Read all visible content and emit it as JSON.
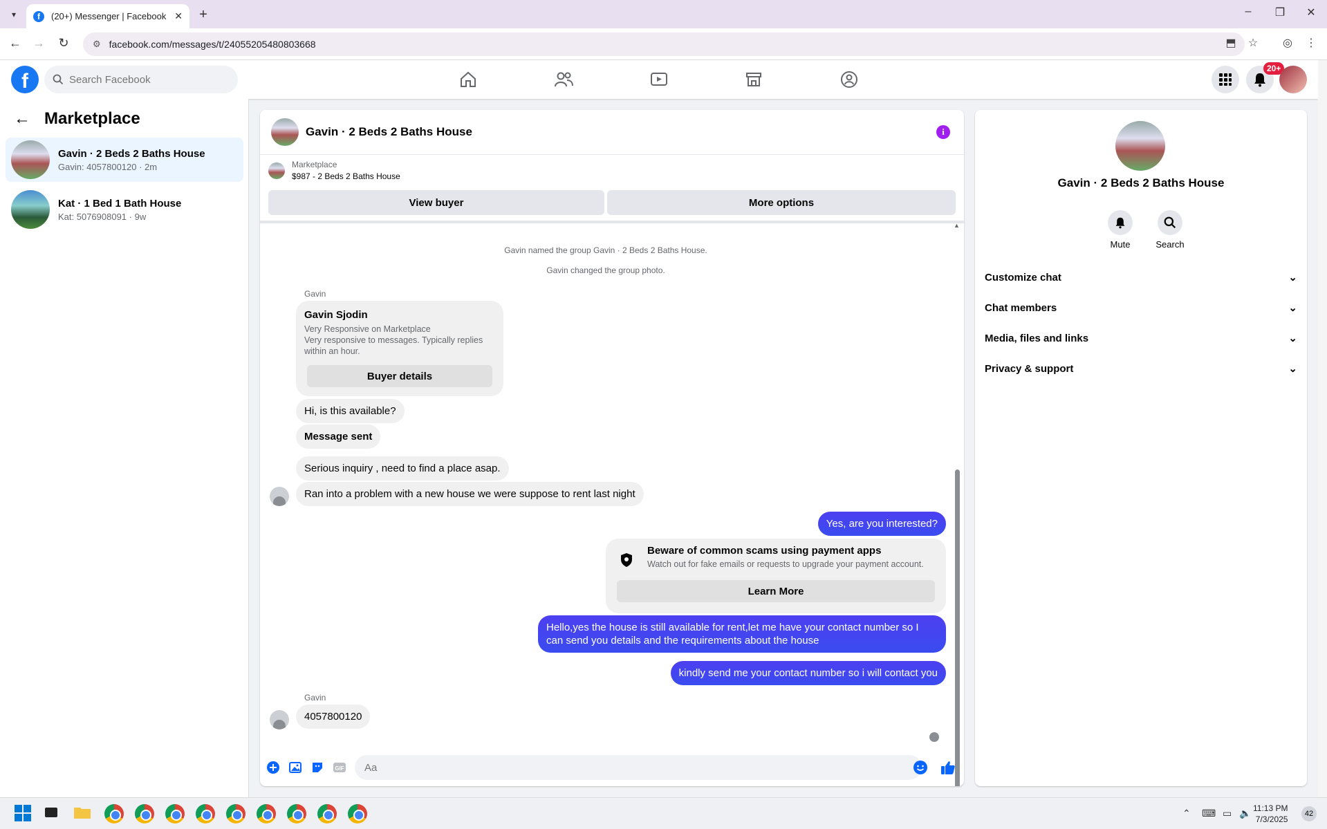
{
  "browser": {
    "tab_title": "(20+) Messenger | Facebook",
    "url": "facebook.com/messages/t/24055205480803668"
  },
  "fb": {
    "logo": "f",
    "search_placeholder": "Search Facebook",
    "notif_badge": "20+",
    "nav_icons": [
      "home-icon",
      "friends-icon",
      "video-icon",
      "marketplace-icon",
      "groups-icon"
    ]
  },
  "sidebar": {
    "title": "Marketplace",
    "conversations": [
      {
        "title": "Gavin · 2 Beds 2 Baths House",
        "subtitle": "Gavin: 4057800120 · 2m"
      },
      {
        "title": "Kat · 1 Bed 1 Bath House",
        "subtitle": "Kat: 5076908091 · 9w"
      }
    ]
  },
  "chat": {
    "title": "Gavin · 2 Beds 2 Baths House",
    "marketplace_label": "Marketplace",
    "listing": "$987 - 2 Beds 2 Baths House",
    "view_buyer": "View buyer",
    "more_options": "More options",
    "system_messages": [
      "Gavin named the group Gavin · 2 Beds 2 Baths House.",
      "Gavin changed the group photo."
    ],
    "sender_name": "Gavin",
    "buyer_card": {
      "name": "Gavin Sjodin",
      "line1": "Very Responsive on Marketplace",
      "line2": "Very responsive to messages. Typically replies",
      "line3": "within an hour.",
      "button": "Buyer details"
    },
    "messages": {
      "m1": "Hi, is this available?",
      "m2": "Message sent",
      "m3": "Serious inquiry , need to find a place asap.",
      "m4": "Ran into a problem with a new house we were suppose to rent last night",
      "m5": "Yes, are you interested?",
      "m6a": "Hello,yes the house is still available for rent,let me have your contact number   so I",
      "m6b": "can send you details and the requirements about the house",
      "m7": "kindly send me your contact number so i will contact you",
      "m8": "4057800120"
    },
    "scam_notice": {
      "title": "Beware of common scams using payment apps",
      "body": "Watch out for fake emails or requests to upgrade your payment account.",
      "button": "Learn More"
    },
    "composer_placeholder": "Aa"
  },
  "info_panel": {
    "name": "Gavin · 2 Beds 2 Baths House",
    "mute": "Mute",
    "search": "Search",
    "sections": [
      "Customize chat",
      "Chat members",
      "Media, files and links",
      "Privacy & support"
    ]
  },
  "taskbar": {
    "time": "11:13 PM",
    "date": "7/3/2025",
    "notifications": "42"
  },
  "colors": {
    "fb_blue": "#1877f2",
    "my_bubble": "#4a3ef5",
    "info_purple": "#a020f0"
  }
}
